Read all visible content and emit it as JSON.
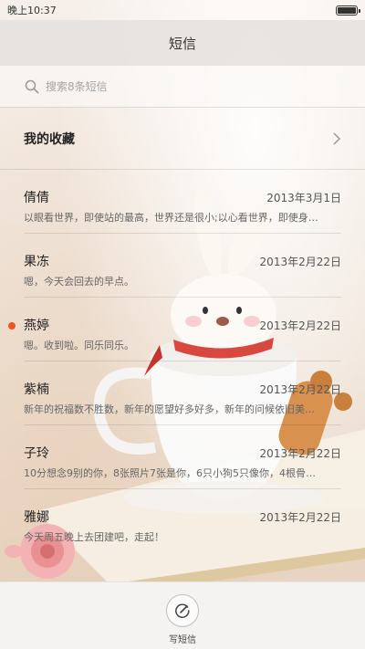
{
  "status_bar": {
    "time": "晚上10:37",
    "battery_level": 1.0
  },
  "title_bar": {
    "title": "短信"
  },
  "search": {
    "placeholder": "搜索8条短信"
  },
  "favorites": {
    "label": "我的收藏"
  },
  "threads": [
    {
      "name": "倩倩",
      "date": "2013年3月1日",
      "preview": "以眼看世界，即使站的最高，世界还是很小;以心看世界，即使身…",
      "unread": false
    },
    {
      "name": "果冻",
      "date": "2013年2月22日",
      "preview": "嗯，今天会回去的早点。",
      "unread": false
    },
    {
      "name": "燕婷",
      "date": "2013年2月22日",
      "preview": "嗯。收到啦。同乐同乐。",
      "unread": true
    },
    {
      "name": "紫楠",
      "date": "2013年2月22日",
      "preview": "新年的祝福数不胜数，新年的愿望好多好多，新年的问候依旧美…",
      "unread": false
    },
    {
      "name": "子玲",
      "date": "2013年2月22日",
      "preview": "10分想念9别的你，8张照片7张是你，6只小狗5只像你，4根骨…",
      "unread": false
    },
    {
      "name": "雅娜",
      "date": "2013年2月22日",
      "preview": "今天周五晚上去团建吧，走起！",
      "unread": false
    }
  ],
  "bottom_bar": {
    "compose_label": "写短信"
  },
  "colors": {
    "unread_dot": "#f0561c",
    "title_bar_bg": "#e4e1de"
  }
}
